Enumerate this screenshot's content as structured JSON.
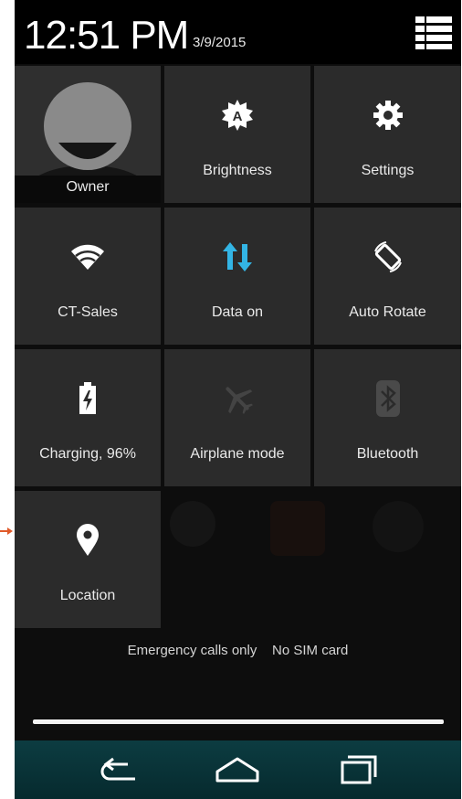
{
  "status_bar": {
    "time": "12:51 PM",
    "date": "3/9/2015"
  },
  "tiles": {
    "owner": {
      "label": "Owner"
    },
    "brightness": {
      "label": "Brightness",
      "icon": "brightness-auto-icon"
    },
    "settings": {
      "label": "Settings",
      "icon": "gear-icon"
    },
    "wifi": {
      "label": "CT-Sales",
      "icon": "wifi-icon"
    },
    "data": {
      "label": "Data on",
      "icon": "data-arrows-icon",
      "accent": "#33b5e5"
    },
    "rotate": {
      "label": "Auto Rotate",
      "icon": "rotate-icon"
    },
    "battery": {
      "label": "Charging, 96%",
      "icon": "battery-charging-icon"
    },
    "airplane": {
      "label": "Airplane mode",
      "icon": "airplane-icon"
    },
    "bluetooth": {
      "label": "Bluetooth",
      "icon": "bluetooth-icon"
    },
    "location": {
      "label": "Location",
      "icon": "location-pin-icon"
    }
  },
  "footer": {
    "emergency_text": "Emergency calls only",
    "sim_text": "No SIM card"
  },
  "colors": {
    "tile_bg": "#2b2b2b",
    "accent_blue": "#33b5e5",
    "nav_bg": "#0c3c41",
    "annotation_arrow": "#e05a2a"
  }
}
